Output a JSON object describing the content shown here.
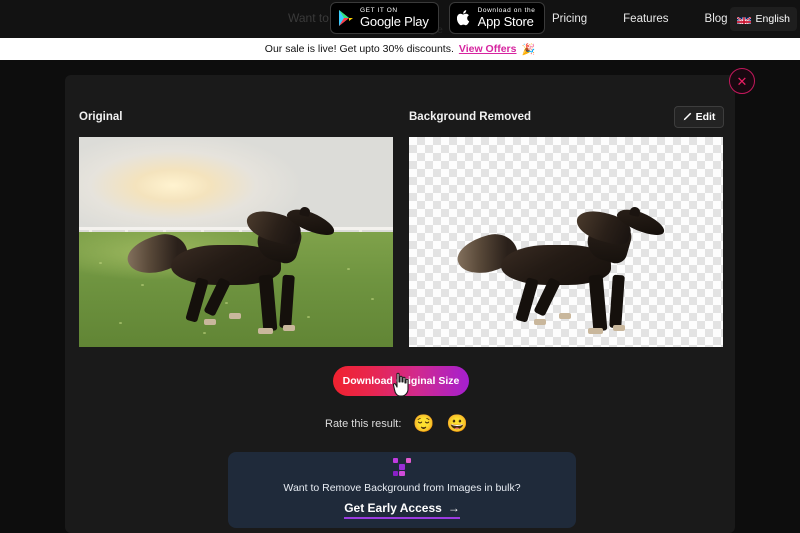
{
  "nav": {
    "ghost_text": "Want to R",
    "ghost_text2": "Get it on Google",
    "badges": [
      {
        "name": "google-play",
        "small": "GET IT ON",
        "big": "Google Play"
      },
      {
        "name": "app-store",
        "small": "Download on the",
        "big": "App Store"
      }
    ],
    "links": [
      "Pricing",
      "Features",
      "Blog"
    ],
    "language": "English"
  },
  "banner": {
    "text": "Our sale is live! Get upto 30% discounts.",
    "link": "View Offers",
    "emoji": "🎉"
  },
  "modal": {
    "close_icon": "✕",
    "original_label": "Original",
    "removed_label": "Background Removed",
    "edit_label": "Edit",
    "download_label": "Download Original Size"
  },
  "rate": {
    "label": "Rate this result:",
    "sad_emoji": "😌",
    "happy_emoji": "😀"
  },
  "promo": {
    "question": "Want to Remove Background from Images in bulk?",
    "cta": "Get Early Access",
    "arrow": "→"
  },
  "colors": {
    "page_bg": "#0d0d0d",
    "modal_bg": "#1a1a1a",
    "accent_pink": "#d6249f",
    "promo_bg": "#1f2a3a",
    "promo_underline": "#9b3ce0",
    "close_ring": "#c2185b"
  }
}
